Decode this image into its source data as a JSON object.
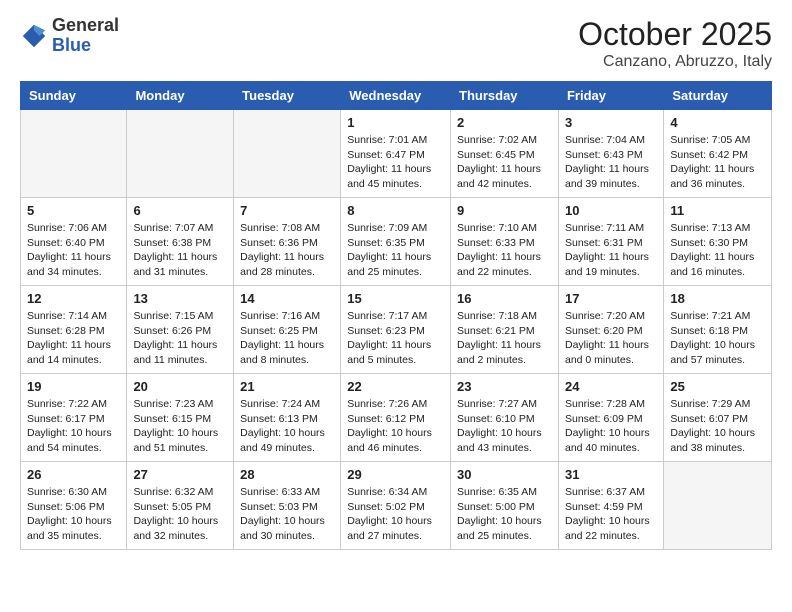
{
  "logo": {
    "general": "General",
    "blue": "Blue"
  },
  "header": {
    "month": "October 2025",
    "location": "Canzano, Abruzzo, Italy"
  },
  "days_of_week": [
    "Sunday",
    "Monday",
    "Tuesday",
    "Wednesday",
    "Thursday",
    "Friday",
    "Saturday"
  ],
  "weeks": [
    [
      {
        "day": "",
        "info": ""
      },
      {
        "day": "",
        "info": ""
      },
      {
        "day": "",
        "info": ""
      },
      {
        "day": "1",
        "info": "Sunrise: 7:01 AM\nSunset: 6:47 PM\nDaylight: 11 hours\nand 45 minutes."
      },
      {
        "day": "2",
        "info": "Sunrise: 7:02 AM\nSunset: 6:45 PM\nDaylight: 11 hours\nand 42 minutes."
      },
      {
        "day": "3",
        "info": "Sunrise: 7:04 AM\nSunset: 6:43 PM\nDaylight: 11 hours\nand 39 minutes."
      },
      {
        "day": "4",
        "info": "Sunrise: 7:05 AM\nSunset: 6:42 PM\nDaylight: 11 hours\nand 36 minutes."
      }
    ],
    [
      {
        "day": "5",
        "info": "Sunrise: 7:06 AM\nSunset: 6:40 PM\nDaylight: 11 hours\nand 34 minutes."
      },
      {
        "day": "6",
        "info": "Sunrise: 7:07 AM\nSunset: 6:38 PM\nDaylight: 11 hours\nand 31 minutes."
      },
      {
        "day": "7",
        "info": "Sunrise: 7:08 AM\nSunset: 6:36 PM\nDaylight: 11 hours\nand 28 minutes."
      },
      {
        "day": "8",
        "info": "Sunrise: 7:09 AM\nSunset: 6:35 PM\nDaylight: 11 hours\nand 25 minutes."
      },
      {
        "day": "9",
        "info": "Sunrise: 7:10 AM\nSunset: 6:33 PM\nDaylight: 11 hours\nand 22 minutes."
      },
      {
        "day": "10",
        "info": "Sunrise: 7:11 AM\nSunset: 6:31 PM\nDaylight: 11 hours\nand 19 minutes."
      },
      {
        "day": "11",
        "info": "Sunrise: 7:13 AM\nSunset: 6:30 PM\nDaylight: 11 hours\nand 16 minutes."
      }
    ],
    [
      {
        "day": "12",
        "info": "Sunrise: 7:14 AM\nSunset: 6:28 PM\nDaylight: 11 hours\nand 14 minutes."
      },
      {
        "day": "13",
        "info": "Sunrise: 7:15 AM\nSunset: 6:26 PM\nDaylight: 11 hours\nand 11 minutes."
      },
      {
        "day": "14",
        "info": "Sunrise: 7:16 AM\nSunset: 6:25 PM\nDaylight: 11 hours\nand 8 minutes."
      },
      {
        "day": "15",
        "info": "Sunrise: 7:17 AM\nSunset: 6:23 PM\nDaylight: 11 hours\nand 5 minutes."
      },
      {
        "day": "16",
        "info": "Sunrise: 7:18 AM\nSunset: 6:21 PM\nDaylight: 11 hours\nand 2 minutes."
      },
      {
        "day": "17",
        "info": "Sunrise: 7:20 AM\nSunset: 6:20 PM\nDaylight: 11 hours\nand 0 minutes."
      },
      {
        "day": "18",
        "info": "Sunrise: 7:21 AM\nSunset: 6:18 PM\nDaylight: 10 hours\nand 57 minutes."
      }
    ],
    [
      {
        "day": "19",
        "info": "Sunrise: 7:22 AM\nSunset: 6:17 PM\nDaylight: 10 hours\nand 54 minutes."
      },
      {
        "day": "20",
        "info": "Sunrise: 7:23 AM\nSunset: 6:15 PM\nDaylight: 10 hours\nand 51 minutes."
      },
      {
        "day": "21",
        "info": "Sunrise: 7:24 AM\nSunset: 6:13 PM\nDaylight: 10 hours\nand 49 minutes."
      },
      {
        "day": "22",
        "info": "Sunrise: 7:26 AM\nSunset: 6:12 PM\nDaylight: 10 hours\nand 46 minutes."
      },
      {
        "day": "23",
        "info": "Sunrise: 7:27 AM\nSunset: 6:10 PM\nDaylight: 10 hours\nand 43 minutes."
      },
      {
        "day": "24",
        "info": "Sunrise: 7:28 AM\nSunset: 6:09 PM\nDaylight: 10 hours\nand 40 minutes."
      },
      {
        "day": "25",
        "info": "Sunrise: 7:29 AM\nSunset: 6:07 PM\nDaylight: 10 hours\nand 38 minutes."
      }
    ],
    [
      {
        "day": "26",
        "info": "Sunrise: 6:30 AM\nSunset: 5:06 PM\nDaylight: 10 hours\nand 35 minutes."
      },
      {
        "day": "27",
        "info": "Sunrise: 6:32 AM\nSunset: 5:05 PM\nDaylight: 10 hours\nand 32 minutes."
      },
      {
        "day": "28",
        "info": "Sunrise: 6:33 AM\nSunset: 5:03 PM\nDaylight: 10 hours\nand 30 minutes."
      },
      {
        "day": "29",
        "info": "Sunrise: 6:34 AM\nSunset: 5:02 PM\nDaylight: 10 hours\nand 27 minutes."
      },
      {
        "day": "30",
        "info": "Sunrise: 6:35 AM\nSunset: 5:00 PM\nDaylight: 10 hours\nand 25 minutes."
      },
      {
        "day": "31",
        "info": "Sunrise: 6:37 AM\nSunset: 4:59 PM\nDaylight: 10 hours\nand 22 minutes."
      },
      {
        "day": "",
        "info": ""
      }
    ]
  ]
}
